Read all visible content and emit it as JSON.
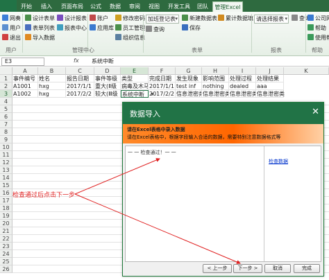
{
  "ribbon_tabs": {
    "file": "",
    "items": [
      "开始",
      "插入",
      "页面布局",
      "公式",
      "数据",
      "审阅",
      "视图",
      "开发工具",
      "团队",
      "管理Excel"
    ],
    "active": "管理Excel"
  },
  "ribbon": {
    "col1": [
      "网奏",
      "用户",
      "退出"
    ],
    "col2": [
      "设计表单",
      "表单列表",
      "导入数据"
    ],
    "col3": [
      "设计报表",
      "报表中心"
    ],
    "col4": [
      "账户",
      "应用库"
    ],
    "col5": [
      "修改密码",
      "员工管理",
      "组织信息"
    ],
    "col6_dropdown": "加班登记表",
    "col6": [
      "查询"
    ],
    "col7": [
      "新建数据表",
      "保存"
    ],
    "col8": [
      "累计数据填"
    ],
    "col9_dropdown": "请选择报表",
    "col10": [
      "查询"
    ],
    "col11": [
      "公司网",
      "帮助",
      "使用帮"
    ],
    "groups": [
      "用户",
      "管理中心",
      "表单",
      "报表",
      "帮助"
    ]
  },
  "formula_bar": {
    "name_box": "E3",
    "fx": "fx",
    "content": "系统中断"
  },
  "sheet": {
    "columns": [
      "A",
      "B",
      "C",
      "D",
      "E",
      "F",
      "G",
      "H",
      "I",
      "J",
      "K"
    ],
    "rows": [
      "1",
      "2",
      "3",
      "4",
      "5",
      "6",
      "7",
      "8",
      "9",
      "10",
      "11",
      "12",
      "13",
      "14",
      "15",
      "16",
      "17",
      "18",
      "19",
      "20",
      "21",
      "22",
      "23",
      "24",
      "25",
      "26"
    ],
    "row1": [
      "事件编号",
      "姓名",
      "报告日期",
      "事件等级",
      "类型",
      "完成日期",
      "发生现象",
      "影响范围",
      "处理过程",
      "处理结果"
    ],
    "row2": [
      "A1001",
      "hxg",
      "2017/1/1",
      "重大(Ⅱ级",
      "病毒及木马",
      "2017/1/1",
      "test inf",
      "nothing",
      "dealed",
      "aaa"
    ],
    "row3": [
      "A1002",
      "hxg",
      "2017/2/2",
      "较大(Ⅲ级",
      "系统中断",
      "2017/2/2",
      "信息泄密类",
      "信息泄密类",
      "信息泄密类",
      "信息泄密类"
    ]
  },
  "dialog": {
    "title": "数据导入",
    "close": "✕",
    "header_title": "请在Excel表格中录入数据",
    "header_desc": "请在Excel表格中，根据字段输入合适的数据，需要特别注意数据格式等",
    "result": "一 一 检查通过！一 一",
    "check_link": "检查数据",
    "buttons": {
      "prev": "< 上一步",
      "next": "下一步 >",
      "cancel": "取消",
      "finish": "完成"
    }
  },
  "annotation": {
    "text": "检查通过后点击下一步",
    "color": "#e02020"
  },
  "colors": {
    "accent": "#217346",
    "dialog_header": "#ff6600"
  }
}
